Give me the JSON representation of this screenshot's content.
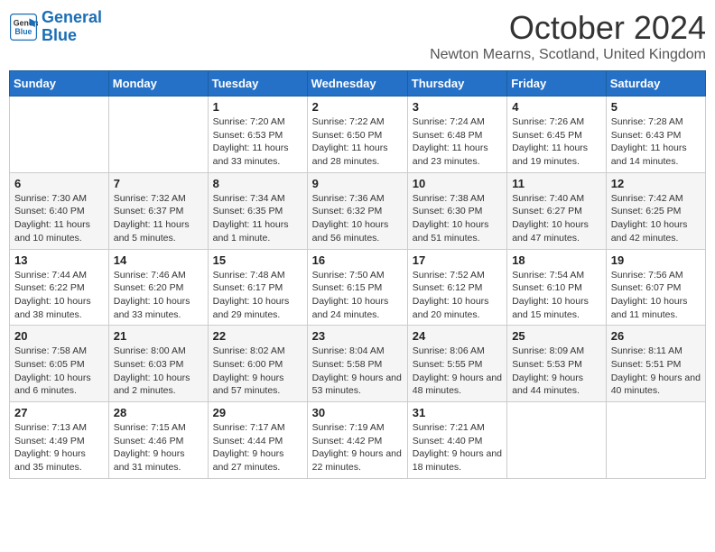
{
  "logo": {
    "line1": "General",
    "line2": "Blue"
  },
  "title": "October 2024",
  "location": "Newton Mearns, Scotland, United Kingdom",
  "days_of_week": [
    "Sunday",
    "Monday",
    "Tuesday",
    "Wednesday",
    "Thursday",
    "Friday",
    "Saturday"
  ],
  "weeks": [
    [
      {
        "num": "",
        "info": ""
      },
      {
        "num": "",
        "info": ""
      },
      {
        "num": "1",
        "info": "Sunrise: 7:20 AM\nSunset: 6:53 PM\nDaylight: 11 hours\nand 33 minutes."
      },
      {
        "num": "2",
        "info": "Sunrise: 7:22 AM\nSunset: 6:50 PM\nDaylight: 11 hours\nand 28 minutes."
      },
      {
        "num": "3",
        "info": "Sunrise: 7:24 AM\nSunset: 6:48 PM\nDaylight: 11 hours\nand 23 minutes."
      },
      {
        "num": "4",
        "info": "Sunrise: 7:26 AM\nSunset: 6:45 PM\nDaylight: 11 hours\nand 19 minutes."
      },
      {
        "num": "5",
        "info": "Sunrise: 7:28 AM\nSunset: 6:43 PM\nDaylight: 11 hours\nand 14 minutes."
      }
    ],
    [
      {
        "num": "6",
        "info": "Sunrise: 7:30 AM\nSunset: 6:40 PM\nDaylight: 11 hours\nand 10 minutes."
      },
      {
        "num": "7",
        "info": "Sunrise: 7:32 AM\nSunset: 6:37 PM\nDaylight: 11 hours\nand 5 minutes."
      },
      {
        "num": "8",
        "info": "Sunrise: 7:34 AM\nSunset: 6:35 PM\nDaylight: 11 hours\nand 1 minute."
      },
      {
        "num": "9",
        "info": "Sunrise: 7:36 AM\nSunset: 6:32 PM\nDaylight: 10 hours\nand 56 minutes."
      },
      {
        "num": "10",
        "info": "Sunrise: 7:38 AM\nSunset: 6:30 PM\nDaylight: 10 hours\nand 51 minutes."
      },
      {
        "num": "11",
        "info": "Sunrise: 7:40 AM\nSunset: 6:27 PM\nDaylight: 10 hours\nand 47 minutes."
      },
      {
        "num": "12",
        "info": "Sunrise: 7:42 AM\nSunset: 6:25 PM\nDaylight: 10 hours\nand 42 minutes."
      }
    ],
    [
      {
        "num": "13",
        "info": "Sunrise: 7:44 AM\nSunset: 6:22 PM\nDaylight: 10 hours\nand 38 minutes."
      },
      {
        "num": "14",
        "info": "Sunrise: 7:46 AM\nSunset: 6:20 PM\nDaylight: 10 hours\nand 33 minutes."
      },
      {
        "num": "15",
        "info": "Sunrise: 7:48 AM\nSunset: 6:17 PM\nDaylight: 10 hours\nand 29 minutes."
      },
      {
        "num": "16",
        "info": "Sunrise: 7:50 AM\nSunset: 6:15 PM\nDaylight: 10 hours\nand 24 minutes."
      },
      {
        "num": "17",
        "info": "Sunrise: 7:52 AM\nSunset: 6:12 PM\nDaylight: 10 hours\nand 20 minutes."
      },
      {
        "num": "18",
        "info": "Sunrise: 7:54 AM\nSunset: 6:10 PM\nDaylight: 10 hours\nand 15 minutes."
      },
      {
        "num": "19",
        "info": "Sunrise: 7:56 AM\nSunset: 6:07 PM\nDaylight: 10 hours\nand 11 minutes."
      }
    ],
    [
      {
        "num": "20",
        "info": "Sunrise: 7:58 AM\nSunset: 6:05 PM\nDaylight: 10 hours\nand 6 minutes."
      },
      {
        "num": "21",
        "info": "Sunrise: 8:00 AM\nSunset: 6:03 PM\nDaylight: 10 hours\nand 2 minutes."
      },
      {
        "num": "22",
        "info": "Sunrise: 8:02 AM\nSunset: 6:00 PM\nDaylight: 9 hours\nand 57 minutes."
      },
      {
        "num": "23",
        "info": "Sunrise: 8:04 AM\nSunset: 5:58 PM\nDaylight: 9 hours\nand 53 minutes."
      },
      {
        "num": "24",
        "info": "Sunrise: 8:06 AM\nSunset: 5:55 PM\nDaylight: 9 hours\nand 48 minutes."
      },
      {
        "num": "25",
        "info": "Sunrise: 8:09 AM\nSunset: 5:53 PM\nDaylight: 9 hours\nand 44 minutes."
      },
      {
        "num": "26",
        "info": "Sunrise: 8:11 AM\nSunset: 5:51 PM\nDaylight: 9 hours\nand 40 minutes."
      }
    ],
    [
      {
        "num": "27",
        "info": "Sunrise: 7:13 AM\nSunset: 4:49 PM\nDaylight: 9 hours\nand 35 minutes."
      },
      {
        "num": "28",
        "info": "Sunrise: 7:15 AM\nSunset: 4:46 PM\nDaylight: 9 hours\nand 31 minutes."
      },
      {
        "num": "29",
        "info": "Sunrise: 7:17 AM\nSunset: 4:44 PM\nDaylight: 9 hours\nand 27 minutes."
      },
      {
        "num": "30",
        "info": "Sunrise: 7:19 AM\nSunset: 4:42 PM\nDaylight: 9 hours\nand 22 minutes."
      },
      {
        "num": "31",
        "info": "Sunrise: 7:21 AM\nSunset: 4:40 PM\nDaylight: 9 hours\nand 18 minutes."
      },
      {
        "num": "",
        "info": ""
      },
      {
        "num": "",
        "info": ""
      }
    ]
  ]
}
